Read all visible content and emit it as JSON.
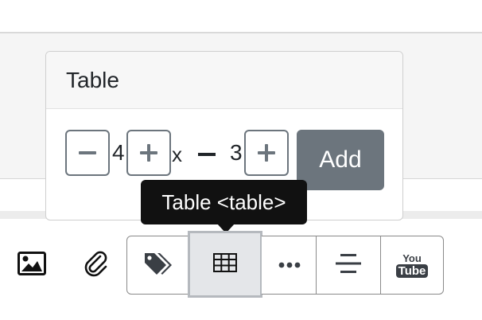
{
  "popover": {
    "title": "Table",
    "rows_value": "4",
    "times_label": "x",
    "cols_value": "3",
    "add_label": "Add"
  },
  "tooltip": {
    "text": "Table <table>"
  },
  "toolbar": {
    "buttons": [
      {
        "icon": "image-icon"
      },
      {
        "icon": "paperclip-icon"
      },
      {
        "icon": "tags-icon"
      },
      {
        "icon": "table-icon",
        "active": true
      },
      {
        "icon": "more-horizontal-icon"
      },
      {
        "icon": "align-center-icon"
      },
      {
        "icon": "youtube-icon",
        "text_top": "You",
        "text_bottom": "Tube"
      }
    ]
  },
  "colors": {
    "secondary": "#6c757d",
    "tooltip_bg": "#111111",
    "active_bg": "#e4e6e9"
  }
}
